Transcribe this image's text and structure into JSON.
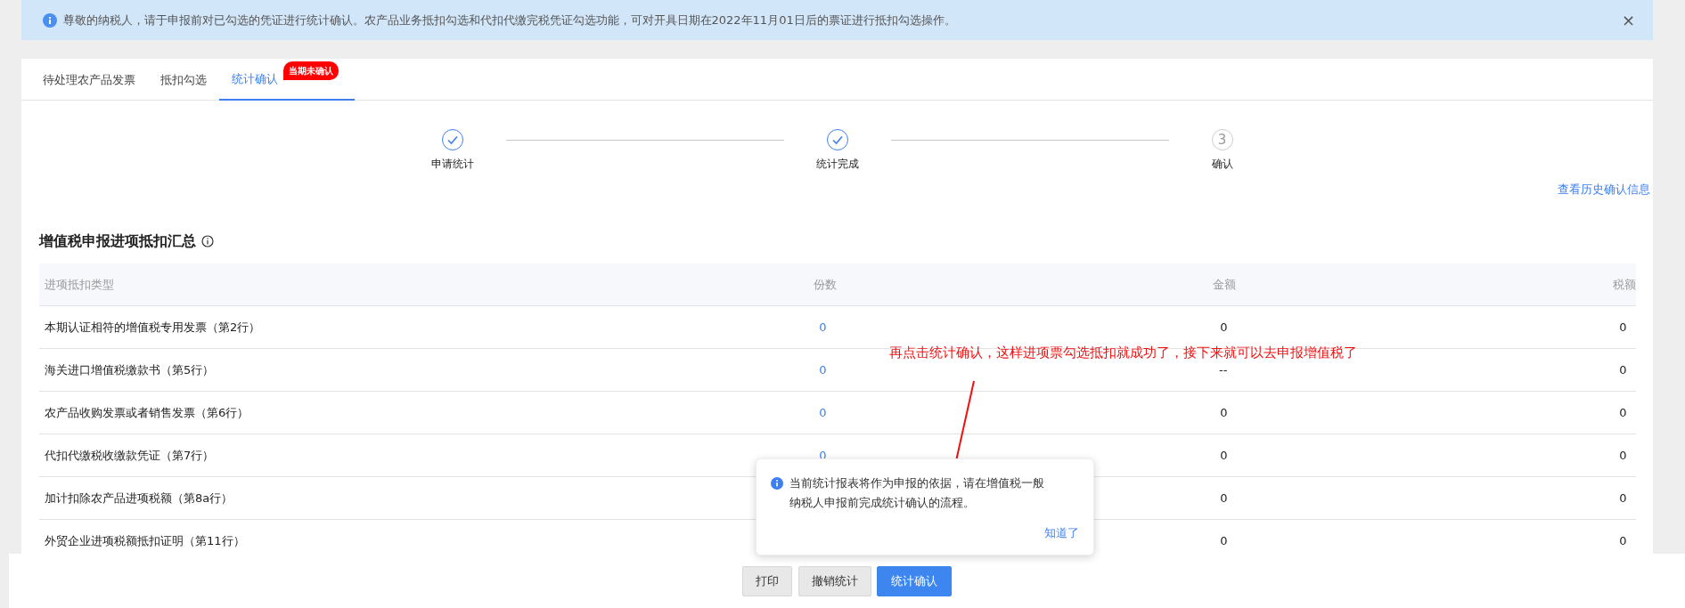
{
  "notice": {
    "text": "尊敬的纳税人，请于申报前对已勾选的凭证进行统计确认。农产品业务抵扣勾选和代扣代缴完税凭证勾选功能，可对开具日期在2022年11月01日后的票证进行抵扣勾选操作。",
    "close": "×"
  },
  "tabs": [
    {
      "label": "待处理农产品发票",
      "selected": false
    },
    {
      "label": "抵扣勾选",
      "selected": false
    },
    {
      "label": "统计确认",
      "selected": true,
      "badge": "当期未确认"
    }
  ],
  "steps": [
    {
      "label": "申请统计",
      "completed": true
    },
    {
      "label": "统计完成",
      "completed": true
    },
    {
      "label": "确认",
      "completed": false,
      "number": "3"
    }
  ],
  "history_link": "查看历史确认信息",
  "section": {
    "title": "增值税申报进项抵扣汇总"
  },
  "table": {
    "columns": [
      "进项抵扣类型",
      "份数",
      "金额",
      "税额"
    ],
    "rows": [
      {
        "type": "本期认证相符的增值税专用发票（第2行）",
        "count": "0",
        "amount": "0",
        "tax": "0"
      },
      {
        "type": "海关进口增值税缴款书（第5行）",
        "count": "0",
        "amount": "--",
        "tax": "0"
      },
      {
        "type": "农产品收购发票或者销售发票（第6行）",
        "count": "0",
        "amount": "0",
        "tax": "0"
      },
      {
        "type": "代扣代缴税收缴款凭证（第7行）",
        "count": "0",
        "amount": "0",
        "tax": "0"
      },
      {
        "type": "加计扣除农产品进项税额（第8a行）",
        "amount": "0",
        "tax": "0"
      },
      {
        "type": "外贸企业进项税额抵扣证明（第11行）",
        "amount": "0",
        "tax": "0"
      }
    ]
  },
  "popover": {
    "text": "当前统计报表将作为申报的依据，请在增值税一般纳税人申报前完成统计确认的流程。",
    "action": "知道了"
  },
  "buttons": [
    {
      "label": "打印",
      "kind": "secondary"
    },
    {
      "label": "撤销统计",
      "kind": "secondary"
    },
    {
      "label": "统计确认",
      "kind": "primary"
    }
  ],
  "annotation": {
    "text": "再点击统计确认，这样进项票勾选抵扣就成功了，接下来就可以去申报增值税了"
  }
}
